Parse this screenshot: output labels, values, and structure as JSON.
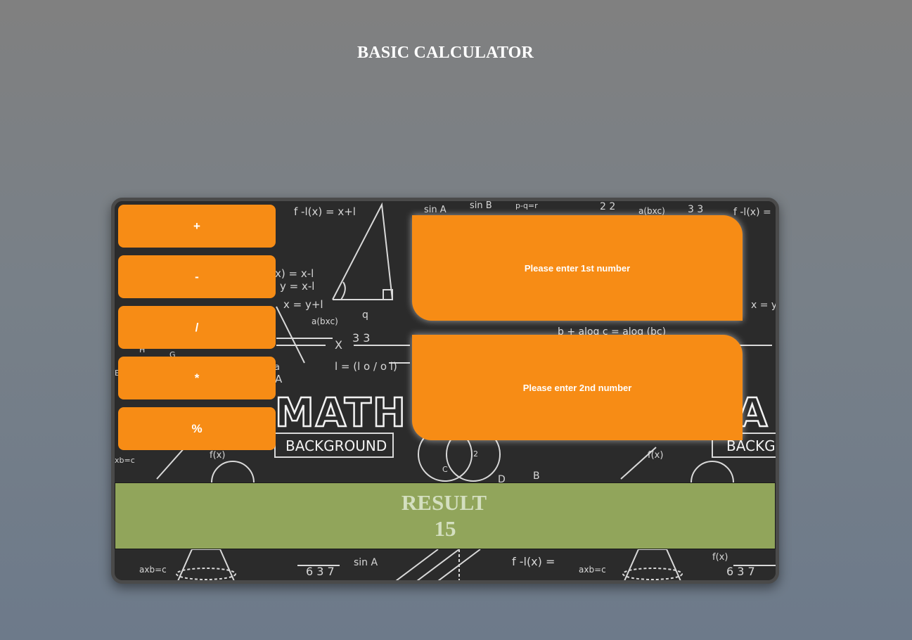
{
  "page": {
    "title": "BASIC CALCULATOR"
  },
  "operations": [
    {
      "label": "+"
    },
    {
      "label": "-"
    },
    {
      "label": "/"
    },
    {
      "label": "*"
    },
    {
      "label": "%"
    }
  ],
  "inputs": {
    "first": {
      "placeholder": "Please enter 1st number"
    },
    "second": {
      "placeholder": "Please enter 2nd number"
    }
  },
  "result": {
    "label": "RESULT",
    "value": "15"
  },
  "background_text": {
    "math": "MATH",
    "background": "BACKGROUND",
    "background_right": "BACKGI",
    "formulas": [
      "f -l(x) = x+l",
      "sin A",
      "sin B",
      "p-q=r",
      "2 2",
      "a(bxc)",
      "3 3",
      "f -l(x) =",
      "x = y+l",
      "y = x-l",
      "x) = x-l",
      "a(bxc)",
      "b + alog c = alog (bc)",
      "xb=c",
      "f(x)",
      "f(x)",
      "x = y+l",
      "axb=c",
      "6 3 7",
      "sin A",
      "f -l(x) =",
      "axb=c",
      "f(x)",
      "6 3 7",
      "D",
      "B",
      "C",
      "2",
      "q",
      "3 3",
      "l = (l o / o l)",
      "X",
      "a",
      "A",
      "H",
      "G",
      "E"
    ]
  },
  "colors": {
    "button_orange": "#f78c15",
    "result_green": "#91a55b",
    "result_text": "#d4dfc0",
    "board_dark": "#2a2a2a"
  }
}
